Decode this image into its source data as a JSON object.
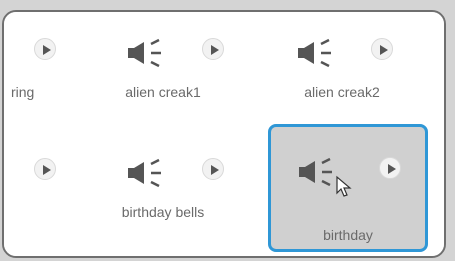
{
  "sounds": [
    {
      "label": "ring"
    },
    {
      "label": "alien creak1"
    },
    {
      "label": "alien creak2"
    },
    {
      "label": ""
    },
    {
      "label": "birthday bells"
    },
    {
      "label": "birthday"
    }
  ],
  "selected_label": "birthday",
  "colors": {
    "selection_border": "#2f97d6",
    "selection_fill": "#d0d0d0",
    "icon": "#555555",
    "label_text": "#6a6a6a"
  },
  "icons": {
    "speaker": "speaker-icon",
    "play": "play-icon",
    "cursor": "mouse-pointer-icon"
  }
}
